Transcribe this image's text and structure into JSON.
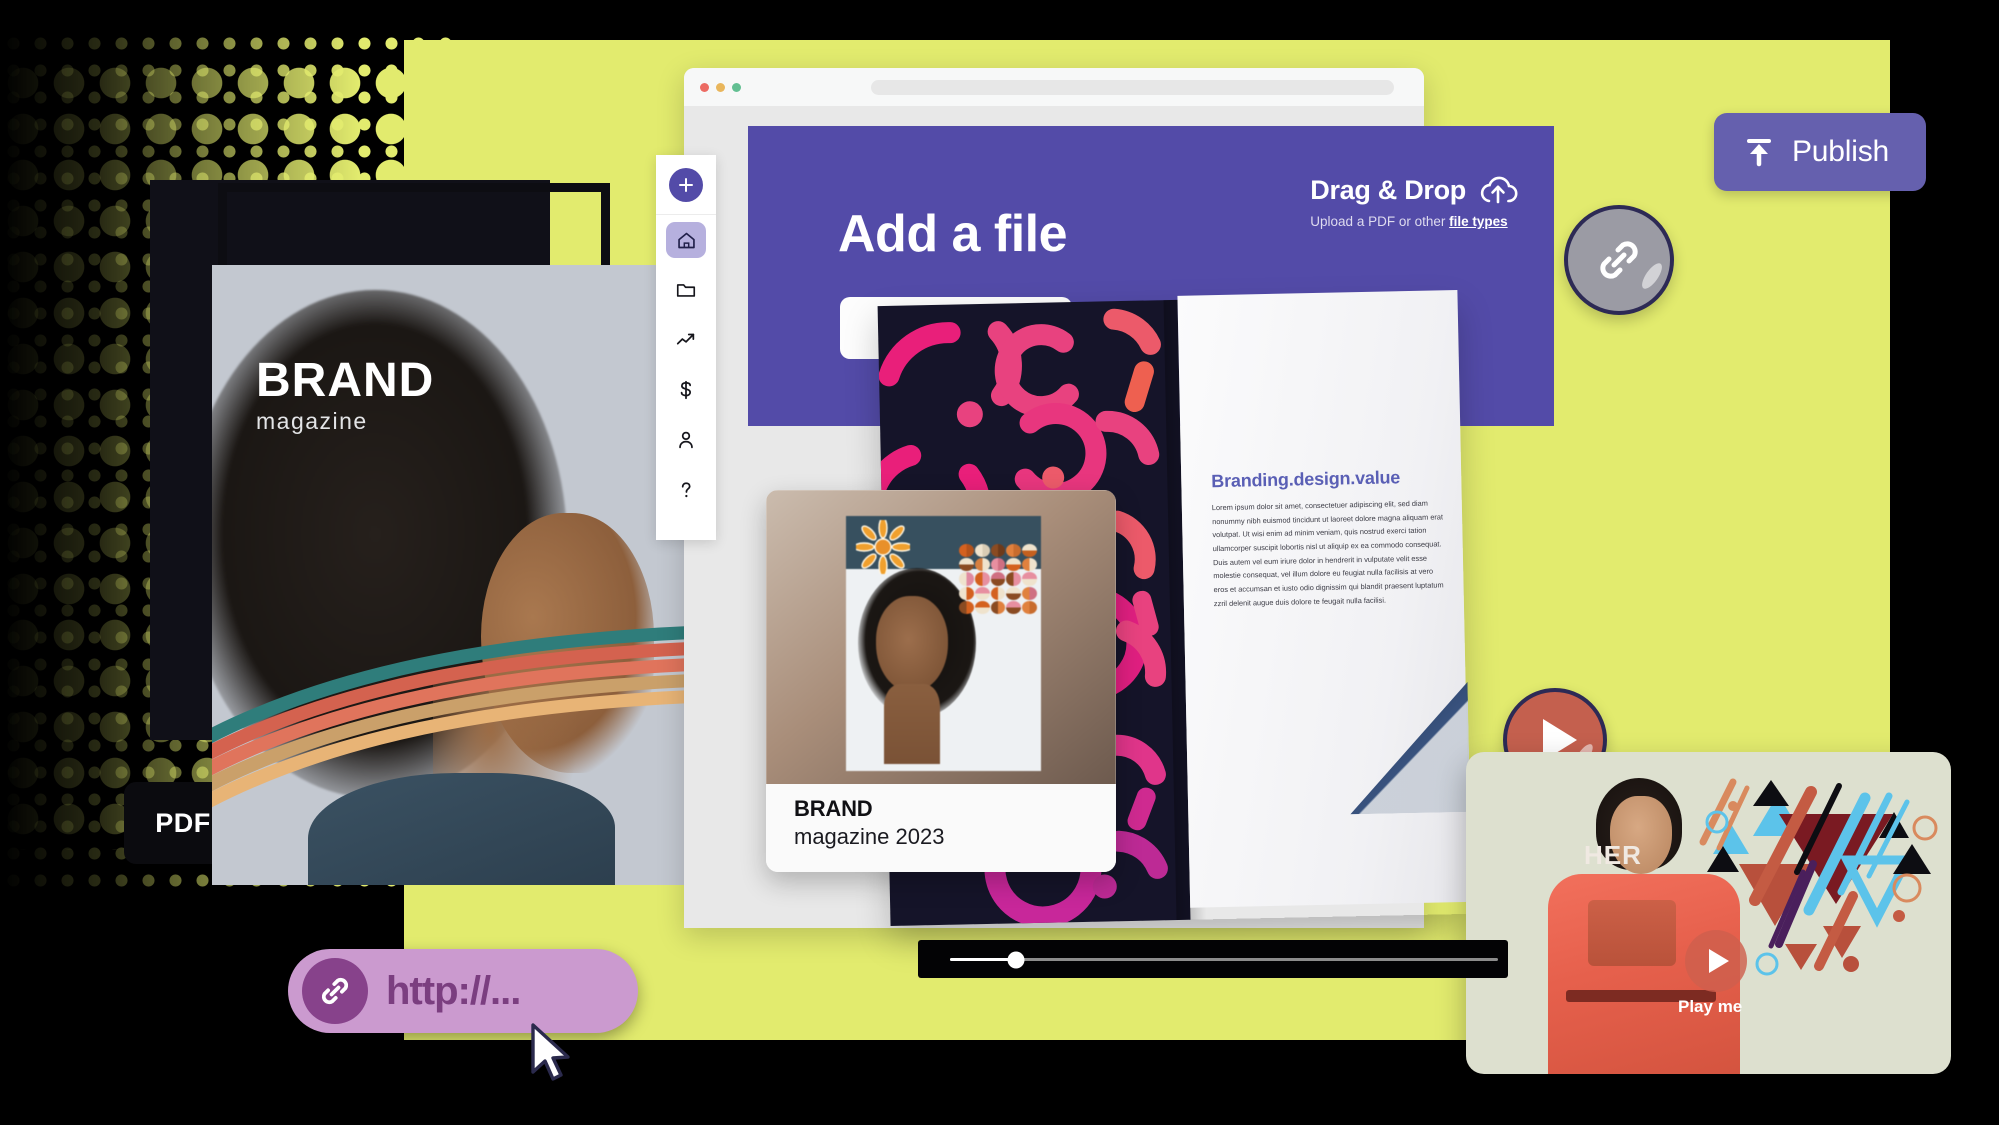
{
  "theme": {
    "accent_purple": "#534ba8",
    "publish_purple": "#6560ae",
    "lime": "#e2eb6e",
    "url_pill": "#cb9acf",
    "url_icon": "#87428b",
    "play_red": "#c4604e",
    "navy_border": "#2d2a55"
  },
  "browser": {
    "dots": [
      "close-red",
      "minimize-yellow",
      "maximize-green"
    ],
    "address_placeholder": ""
  },
  "sidebar": {
    "add_button_label": "+",
    "items": [
      {
        "icon": "home-icon",
        "label": "Home",
        "active": true
      },
      {
        "icon": "folder-icon",
        "label": "Files",
        "active": false
      },
      {
        "icon": "analytics-icon",
        "label": "Analytics",
        "active": false
      },
      {
        "icon": "dollar-icon",
        "label": "Billing",
        "active": false
      },
      {
        "icon": "user-icon",
        "label": "Account",
        "active": false
      },
      {
        "icon": "help-icon",
        "label": "Help",
        "active": false
      }
    ]
  },
  "upload_panel": {
    "title": "Add a file",
    "drag_drop_title": "Drag & Drop",
    "drag_drop_icon": "cloud-upload-icon",
    "subtitle_prefix": "Upload a PDF or other ",
    "subtitle_link": "file types",
    "file_button_label": ""
  },
  "publish": {
    "label": "Publish",
    "icon": "upload-icon"
  },
  "magazine_cover": {
    "title": "BRAND",
    "subtitle": "magazine",
    "pdf_badge": "PDF"
  },
  "brand_card": {
    "title": "BRAND",
    "subtitle": "magazine 2023"
  },
  "document_page": {
    "heading": "Branding.design.value",
    "body": "Lorem ipsum dolor sit amet, consectetuer adipiscing elit, sed diam nonummy nibh euismod tincidunt ut laoreet dolore magna aliquam erat volutpat. Ut wisi enim ad minim veniam, quis nostrud exerci tation ullamcorper suscipit lobortis nisl ut aliquip ex ea commodo consequat. Duis autem vel eum iriure dolor in hendrerit in vulputate velit esse molestie consequat, vel illum dolore eu feugiat nulla facilisis at vero eros et accumsan et iusto odio dignissim qui blandit praesent luptatum zzril delenit augue duis dolore te feugait nulla facilisi."
  },
  "link_button": {
    "icon": "link-icon",
    "label": "Copy link"
  },
  "play_button": {
    "icon": "play-icon",
    "label": "Play"
  },
  "video_card": {
    "overlay_title": "HER",
    "play_label": "Play me",
    "play_icon": "play-icon"
  },
  "player": {
    "progress_percent": 12
  },
  "url_pill": {
    "icon": "link-icon",
    "text": "http://...",
    "cursor": "arrow-cursor"
  }
}
